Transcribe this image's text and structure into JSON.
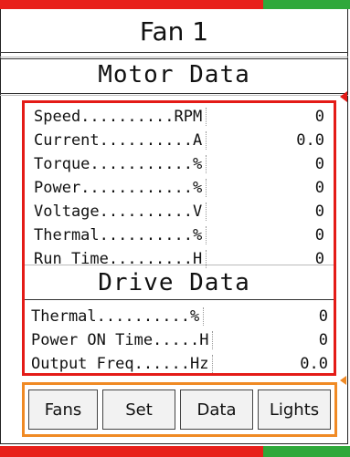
{
  "title": "Fan 1",
  "motor": {
    "heading": "Motor Data",
    "rows": [
      {
        "label": "Speed..........RPM",
        "value": "0"
      },
      {
        "label": "Current..........A",
        "value": "0.0"
      },
      {
        "label": "Torque...........%",
        "value": "0"
      },
      {
        "label": "Power............%",
        "value": "0"
      },
      {
        "label": "Voltage..........V",
        "value": "0"
      },
      {
        "label": "Thermal..........%",
        "value": "0"
      },
      {
        "label": "Run Time.........H",
        "value": "0"
      }
    ]
  },
  "drive": {
    "heading": "Drive Data",
    "rows": [
      {
        "label": "Thermal..........%",
        "value": "0"
      },
      {
        "label": "Power ON Time.....H",
        "value": "0"
      },
      {
        "label": "Output Freq......Hz",
        "value": "0.0"
      }
    ]
  },
  "nav": {
    "fans": "Fans",
    "set": "Set",
    "data": "Data",
    "lights": "Lights"
  },
  "colors": {
    "status_red": "#e8201a",
    "status_green": "#2fa83a",
    "data_box_outline": "#e41b17",
    "nav_box_outline": "#f08a24"
  }
}
